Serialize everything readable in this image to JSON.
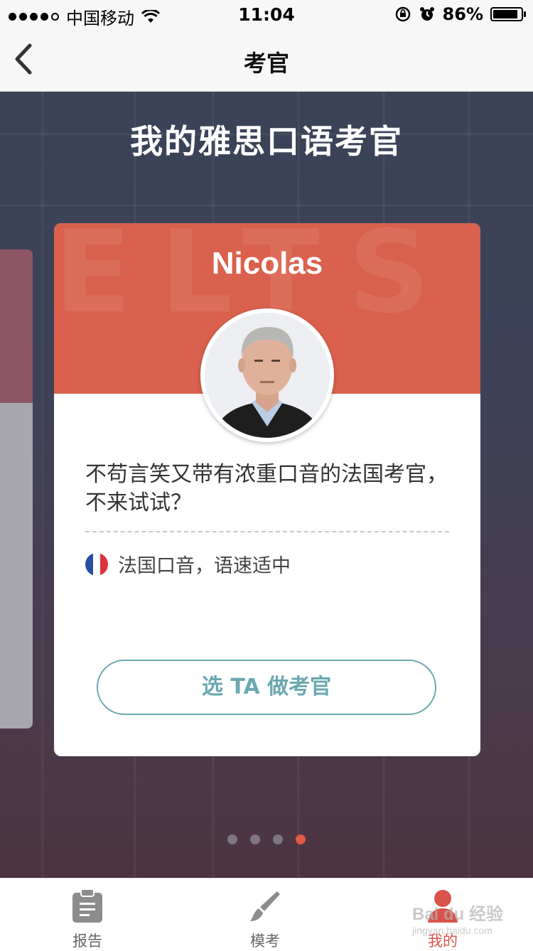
{
  "status_bar": {
    "carrier": "中国移动",
    "time": "11:04",
    "battery": "86%"
  },
  "nav": {
    "title": "考官"
  },
  "page": {
    "heading": "我的雅思口语考官"
  },
  "card": {
    "name": "Nicolas",
    "background_letters": "ELTS",
    "description": "不苟言笑又带有浓重口音的法国考官，不来试试？",
    "accent": "法国口音，语速适中",
    "flag": "france-flag",
    "select_label": "选 TA 做考官"
  },
  "pager": {
    "count": 4,
    "active_index": 3
  },
  "tabs": [
    {
      "label": "报告",
      "icon": "clipboard-icon",
      "active": false
    },
    {
      "label": "模考",
      "icon": "brush-icon",
      "active": false
    },
    {
      "label": "我的",
      "icon": "profile-icon",
      "active": true
    }
  ],
  "watermark": {
    "brand": "Bai du 经验",
    "url": "jingyan.baidu.com"
  },
  "colors": {
    "card_header": "#d9614d",
    "button_accent": "#6aa8b0",
    "tab_active": "#d9534a",
    "pager_active": "#e05a49"
  }
}
